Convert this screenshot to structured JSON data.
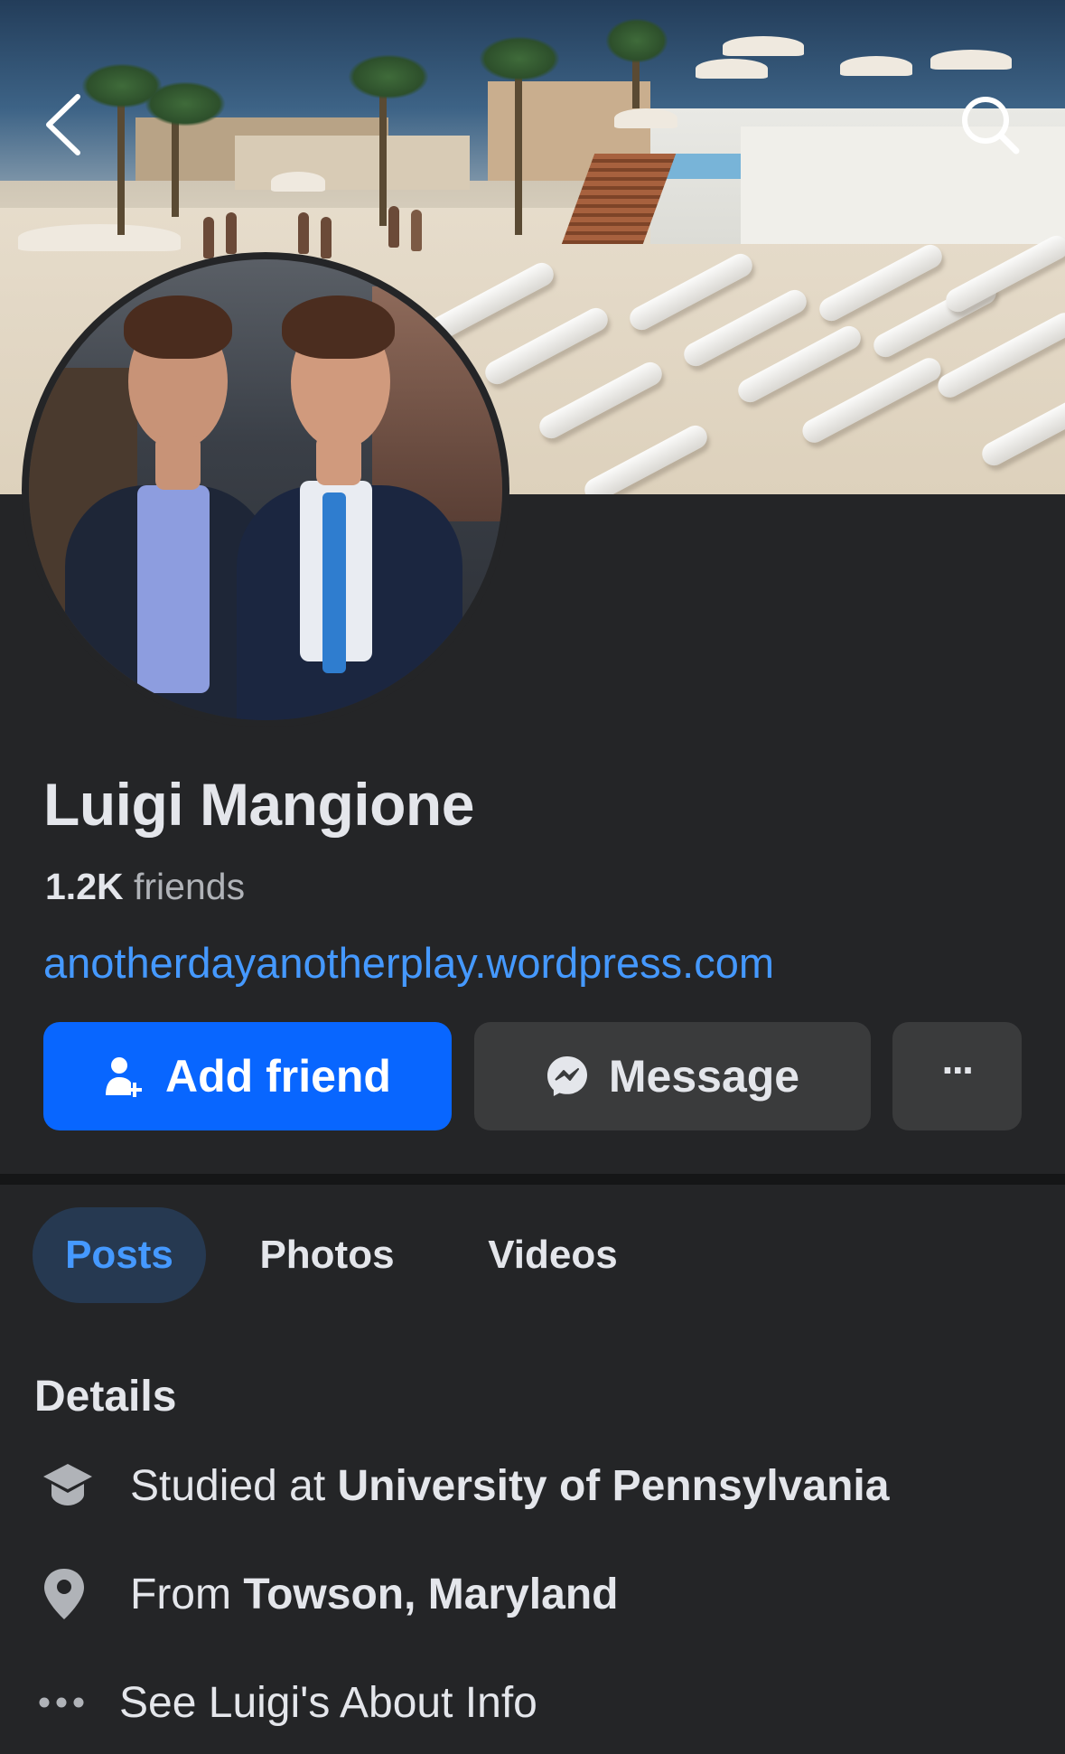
{
  "nav": {
    "back_icon": "back-chevron-icon",
    "search_icon": "search-icon"
  },
  "profile": {
    "name": "Luigi Mangione",
    "friends_count": "1.2K",
    "friends_label": "friends",
    "website": "anotherdayanotherplay.wordpress.com"
  },
  "actions": {
    "add_friend": "Add friend",
    "message": "Message",
    "more": "···"
  },
  "tabs": [
    {
      "label": "Posts",
      "active": true
    },
    {
      "label": "Photos",
      "active": false
    },
    {
      "label": "Videos",
      "active": false
    }
  ],
  "details": {
    "title": "Details",
    "education_prefix": "Studied at",
    "education_school": "University of Pennsylvania",
    "from_prefix": "From",
    "from_place": "Towson, Maryland",
    "about_link": "See Luigi's About Info"
  },
  "colors": {
    "background": "#242527",
    "accent": "#0866ff",
    "link": "#4599ff",
    "button_secondary": "#3a3b3c",
    "tab_active_bg": "#263951"
  }
}
